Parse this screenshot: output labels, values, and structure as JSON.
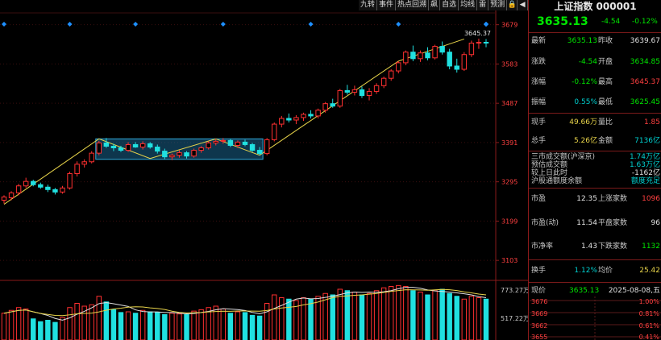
{
  "toolbar": {
    "buttons": [
      "九转",
      "事件",
      "热点回溯",
      "飙",
      "自选",
      "均线",
      "雷",
      "预测"
    ],
    "icons": [
      "lock-icon",
      "left-arrow-icon",
      "up-arrow-icon",
      "down-arrow-icon",
      "right-arrow-icon",
      "zoom-in-icon",
      "zoom-out-icon"
    ]
  },
  "price_axis": [
    "3679",
    "3583",
    "3487",
    "3391",
    "3295",
    "3199",
    "3103"
  ],
  "volume_axis": [
    "773.27万",
    "517.22万"
  ],
  "peak_label": "3645.37",
  "chart_data": {
    "type": "candlestick",
    "ylim": [
      3060,
      3700
    ],
    "ohlc": [
      [
        3250,
        3262,
        3242,
        3258
      ],
      [
        3256,
        3272,
        3250,
        3268
      ],
      [
        3268,
        3290,
        3262,
        3285
      ],
      [
        3285,
        3305,
        3280,
        3296
      ],
      [
        3296,
        3300,
        3284,
        3288
      ],
      [
        3288,
        3293,
        3278,
        3282
      ],
      [
        3282,
        3288,
        3270,
        3276
      ],
      [
        3276,
        3280,
        3264,
        3270
      ],
      [
        3270,
        3285,
        3266,
        3280
      ],
      [
        3280,
        3320,
        3276,
        3315
      ],
      [
        3315,
        3345,
        3308,
        3338
      ],
      [
        3338,
        3350,
        3330,
        3344
      ],
      [
        3344,
        3370,
        3340,
        3365
      ],
      [
        3365,
        3395,
        3360,
        3390
      ],
      [
        3390,
        3402,
        3378,
        3382
      ],
      [
        3382,
        3388,
        3370,
        3378
      ],
      [
        3378,
        3383,
        3368,
        3372
      ],
      [
        3372,
        3392,
        3368,
        3386
      ],
      [
        3386,
        3392,
        3378,
        3380
      ],
      [
        3380,
        3394,
        3374,
        3388
      ],
      [
        3388,
        3392,
        3376,
        3380
      ],
      [
        3380,
        3386,
        3364,
        3370
      ],
      [
        3370,
        3376,
        3350,
        3356
      ],
      [
        3356,
        3364,
        3348,
        3360
      ],
      [
        3360,
        3372,
        3354,
        3366
      ],
      [
        3366,
        3370,
        3352,
        3358
      ],
      [
        3358,
        3376,
        3354,
        3372
      ],
      [
        3372,
        3382,
        3366,
        3378
      ],
      [
        3378,
        3394,
        3374,
        3390
      ],
      [
        3390,
        3400,
        3384,
        3394
      ],
      [
        3394,
        3402,
        3388,
        3396
      ],
      [
        3396,
        3400,
        3380,
        3384
      ],
      [
        3384,
        3396,
        3378,
        3392
      ],
      [
        3392,
        3398,
        3382,
        3386
      ],
      [
        3386,
        3390,
        3368,
        3372
      ],
      [
        3372,
        3380,
        3360,
        3364
      ],
      [
        3364,
        3402,
        3360,
        3398
      ],
      [
        3398,
        3440,
        3394,
        3436
      ],
      [
        3436,
        3456,
        3428,
        3450
      ],
      [
        3450,
        3462,
        3440,
        3446
      ],
      [
        3446,
        3458,
        3436,
        3452
      ],
      [
        3452,
        3464,
        3444,
        3460
      ],
      [
        3460,
        3470,
        3450,
        3456
      ],
      [
        3456,
        3474,
        3450,
        3470
      ],
      [
        3470,
        3490,
        3464,
        3486
      ],
      [
        3486,
        3498,
        3476,
        3480
      ],
      [
        3480,
        3522,
        3476,
        3518
      ],
      [
        3518,
        3532,
        3508,
        3514
      ],
      [
        3514,
        3530,
        3506,
        3520
      ],
      [
        3520,
        3528,
        3500,
        3506
      ],
      [
        3506,
        3524,
        3494,
        3516
      ],
      [
        3516,
        3536,
        3510,
        3530
      ],
      [
        3530,
        3552,
        3524,
        3548
      ],
      [
        3548,
        3570,
        3542,
        3566
      ],
      [
        3566,
        3590,
        3560,
        3586
      ],
      [
        3586,
        3616,
        3580,
        3612
      ],
      [
        3612,
        3628,
        3590,
        3596
      ],
      [
        3596,
        3616,
        3588,
        3610
      ],
      [
        3610,
        3624,
        3592,
        3598
      ],
      [
        3598,
        3630,
        3594,
        3626
      ],
      [
        3626,
        3638,
        3606,
        3612
      ],
      [
        3612,
        3620,
        3570,
        3578
      ],
      [
        3578,
        3596,
        3562,
        3570
      ],
      [
        3570,
        3612,
        3566,
        3606
      ],
      [
        3606,
        3640,
        3600,
        3634
      ],
      [
        3634,
        3645,
        3620,
        3636
      ],
      [
        3636,
        3644,
        3624,
        3635
      ]
    ],
    "volume": [
      380,
      420,
      460,
      440,
      300,
      260,
      280,
      250,
      320,
      460,
      520,
      480,
      500,
      620,
      540,
      430,
      390,
      400,
      380,
      420,
      400,
      390,
      360,
      380,
      370,
      360,
      410,
      430,
      460,
      480,
      440,
      380,
      400,
      390,
      350,
      340,
      520,
      640,
      600,
      580,
      560,
      600,
      580,
      620,
      660,
      640,
      720,
      700,
      680,
      640,
      660,
      700,
      740,
      760,
      773,
      760,
      700,
      680,
      640,
      700,
      720,
      660,
      620,
      580,
      620,
      600,
      580
    ]
  },
  "panel": {
    "title": "上证指数 000001",
    "price": "3635.13",
    "change": "-4.54",
    "pct": "-0.12%",
    "rows": [
      {
        "l1": "最新",
        "v1": "3635.13",
        "l2": "昨收",
        "v2": "3639.67"
      },
      {
        "l1": "涨跌",
        "v1": "-4.54",
        "l2": "开盘",
        "v2": "3634.85"
      },
      {
        "l1": "涨幅",
        "v1": "-0.12%",
        "l2": "最高",
        "v2": "3645.37"
      },
      {
        "l1": "振幅",
        "v1": "0.55%",
        "l2": "最低",
        "v2": "3625.45"
      },
      {
        "l1": "现手",
        "v1": "49.66万",
        "l2": "量比",
        "v2": "1.85"
      },
      {
        "l1": "总手",
        "v1": "5.26亿",
        "l2": "金额",
        "v2": "7136亿"
      }
    ],
    "market": [
      {
        "l": "三市成交额(沪深京)",
        "v": "1.74万亿"
      },
      {
        "l": "预估成交额",
        "v": "1.63万亿"
      },
      {
        "l": "较上日此时",
        "v": "-1162亿"
      },
      {
        "l": "沪股通额度余额",
        "v": "额度充足"
      }
    ],
    "valuation": [
      {
        "l1": "市盈",
        "v1": "12.35",
        "l2": "上涨家数",
        "v2": "1096"
      },
      {
        "l1": "市盈(动)",
        "v1": "11.54",
        "l2": "平盘家数",
        "v2": "96"
      },
      {
        "l1": "市净率",
        "v1": "1.43",
        "l2": "下跌家数",
        "v2": "1132"
      },
      {
        "l1": "换手",
        "v1": "1.12%",
        "l2": "均价",
        "v2": "25.42"
      }
    ],
    "bottom": {
      "label": "现价",
      "price": "3635.13",
      "date": "2025-08-08,五"
    },
    "mini_left": [
      "3676",
      "3669",
      "3662",
      "3655"
    ],
    "mini_right": [
      "1.00%",
      "0.81%",
      "0.61%",
      "0.41%"
    ]
  }
}
